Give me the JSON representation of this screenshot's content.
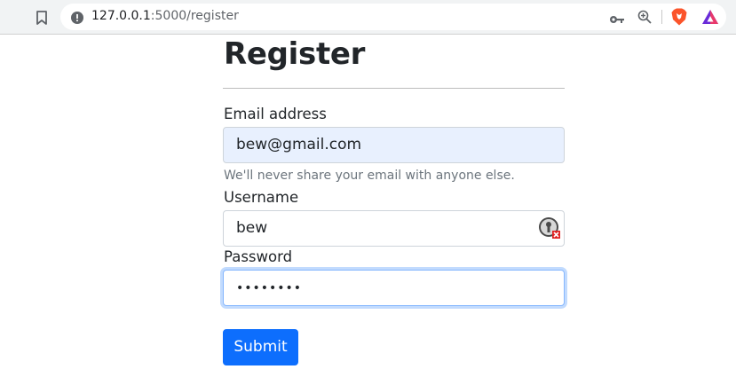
{
  "browser": {
    "url_host": "127.0.0.1",
    "url_path": ":5000/register",
    "icons": [
      "bookmark-icon",
      "site-info-icon",
      "key-icon",
      "zoom-icon",
      "brave-shields-icon",
      "brave-rewards-icon"
    ]
  },
  "page": {
    "title": "Register"
  },
  "form": {
    "email": {
      "label": "Email address",
      "value": "bew@gmail.com",
      "help": "We'll never share your email with anyone else."
    },
    "username": {
      "label": "Username",
      "value": "bew"
    },
    "password": {
      "label": "Password",
      "value": "••••••••"
    },
    "submit_label": "Submit"
  },
  "colors": {
    "primary": "#0d6efd",
    "autofill_bg": "#e8f0fe",
    "help_text": "#6c757d",
    "focus_border": "#86b7fe"
  }
}
